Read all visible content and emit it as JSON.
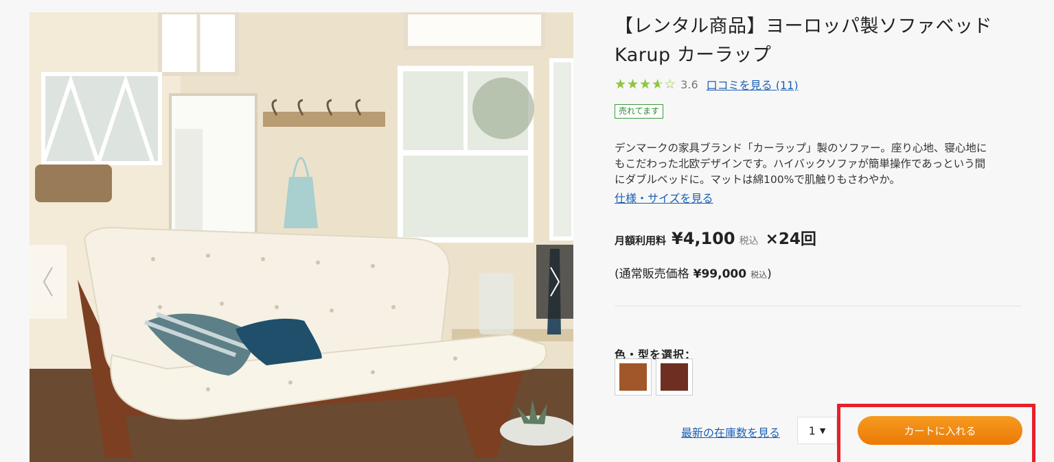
{
  "product": {
    "title_line1": "【レンタル商品】ヨーロッパ製ソファベッド",
    "title_line2": "Karup カーラップ",
    "rating": {
      "stars": "★★★★☆",
      "value": "3.6",
      "value_fraction": 0.72,
      "review_link": "口コミを見る (11)"
    },
    "badge": "売れてます",
    "description": [
      "デンマークの家具ブランド「カーラップ」製のソファー。座り心地、寝心地に",
      "もこだわった北欧デザインです。ハイバックソファが簡単操作であっという間",
      "にダブルベッドに。マットは綿100%で肌触りもさわやか。"
    ],
    "spec_link": "仕様・サイズを見る"
  },
  "pricing": {
    "monthly_label": "月額利用料",
    "monthly_price": "¥4,100",
    "monthly_tax": "税込",
    "installments": "×24回",
    "regular_open": "(通常販売価格",
    "regular_price": "¥99,000",
    "regular_tax": "税込",
    "regular_close": ")"
  },
  "options": {
    "label": "色・型を選択：",
    "swatches": [
      {
        "name": "light-brown",
        "color": "#a0572a"
      },
      {
        "name": "dark-brown",
        "color": "#6e2e22"
      }
    ]
  },
  "purchase": {
    "stock_link": "最新の在庫数を見る",
    "quantity": "1",
    "quantity_arrow": "▼",
    "cart_button": "カートに入れる"
  },
  "colors": {
    "accent_orange": "#ef8208",
    "link_blue": "#1a5fb4",
    "star_green": "#8cc63f",
    "highlight_red": "#e8202a"
  }
}
